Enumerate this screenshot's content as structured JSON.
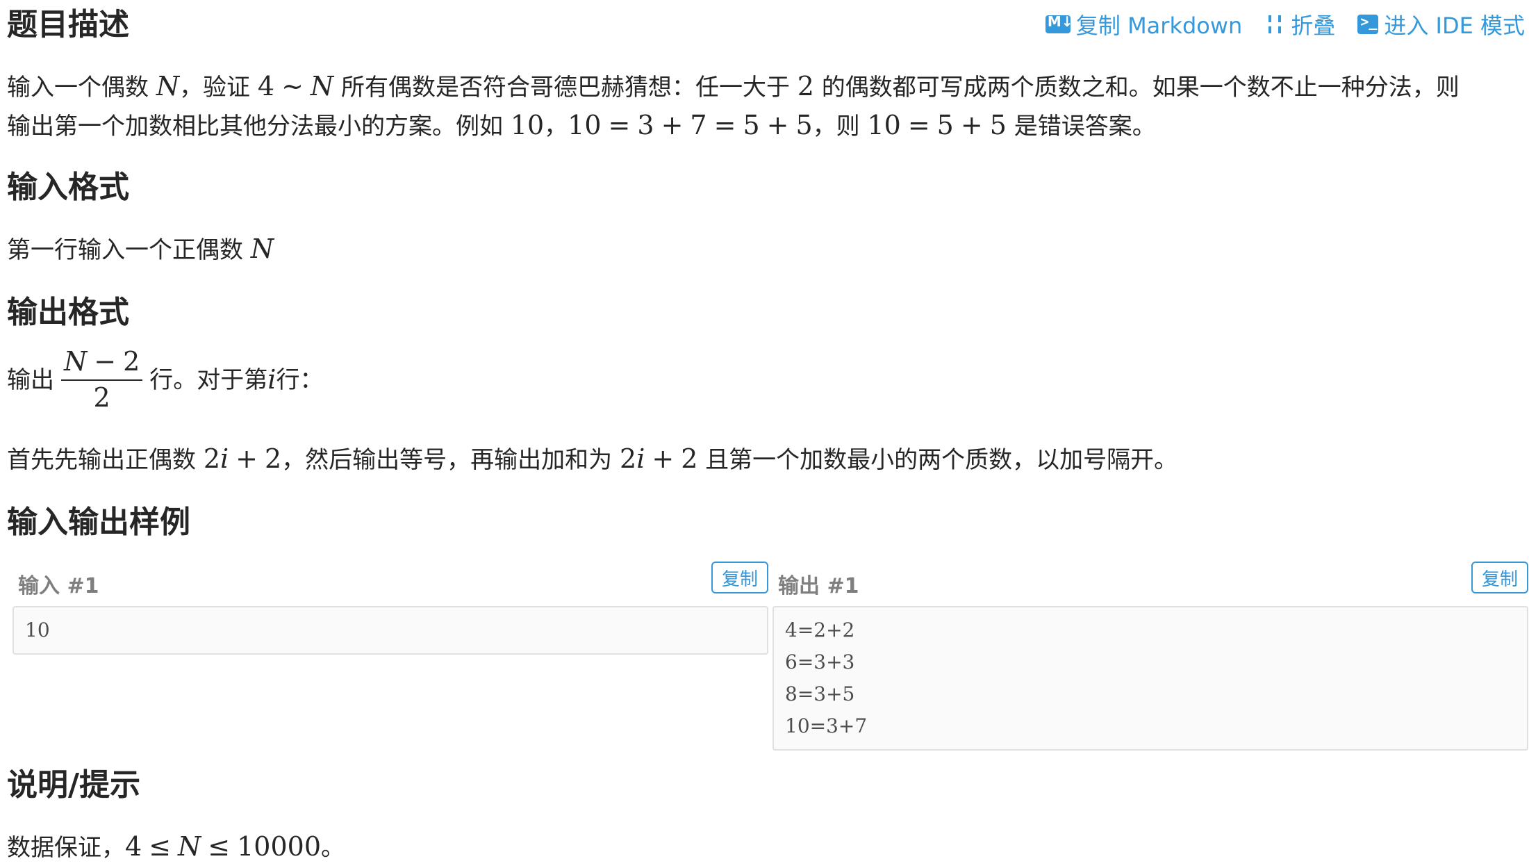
{
  "toolbar": {
    "copy_markdown": "复制 Markdown",
    "fold": "折叠",
    "ide_mode": "进入 IDE 模式",
    "accent": "#3498db"
  },
  "description": {
    "heading": "题目描述",
    "line1": {
      "t1": "输入一个偶数 ",
      "N": "N",
      "t2": "，验证 ",
      "four": "4",
      "sim": "∼",
      "N2": "N",
      "t3": " 所有偶数是否符合哥德巴赫猜想：任一大于 ",
      "two": "2",
      "t4": " 的偶数都可写成两个质数之和。如果一个数不止一种分法，则"
    },
    "line2": {
      "t1": "输出第一个加数相比其他分法最小的方案。例如 ",
      "a": "10",
      "t2": "，",
      "b": "10",
      "eq1": "=",
      "c": "3",
      "plus1": "+",
      "d": "7",
      "eq2": "=",
      "e": "5",
      "plus2": "+",
      "f": "5",
      "t3": "，则 ",
      "g": "10",
      "eq3": "=",
      "h": "5",
      "plus3": "+",
      "i": "5",
      "t4": " 是错误答案。"
    }
  },
  "input_format": {
    "heading": "输入格式",
    "text": "第一行输入一个正偶数 ",
    "N": "N"
  },
  "output_format": {
    "heading": "输出格式",
    "line1": {
      "t1": "输出",
      "num_N": "N",
      "num_minus": "−",
      "num_2": "2",
      "den": "2",
      "t2": "行。对于第 ",
      "i": "i",
      "t3": " 行："
    },
    "line2": {
      "t1": "首先先输出正偶数 ",
      "a2": "2",
      "ai": "i",
      "plus": "+",
      "a3": "2",
      "t2": "，然后输出等号，再输出加和为 ",
      "b2": "2",
      "bi": "i",
      "bplus": "+",
      "b3": "2",
      "t3": " 且第一个加数最小的两个质数，以加号隔开。"
    }
  },
  "samples": {
    "heading": "输入输出样例",
    "input": {
      "title": "输入 #1",
      "copy": "复制",
      "lines": [
        "10"
      ]
    },
    "output": {
      "title": "输出 #1",
      "copy": "复制",
      "lines": [
        "4=2+2",
        "6=3+3",
        "8=3+5",
        "10=3+7"
      ]
    }
  },
  "hint": {
    "heading": "说明/提示",
    "t1": "数据保证，",
    "four": "4",
    "le1": "≤",
    "N": "N",
    "le2": "≤",
    "max": "10000",
    "t2": "。"
  }
}
